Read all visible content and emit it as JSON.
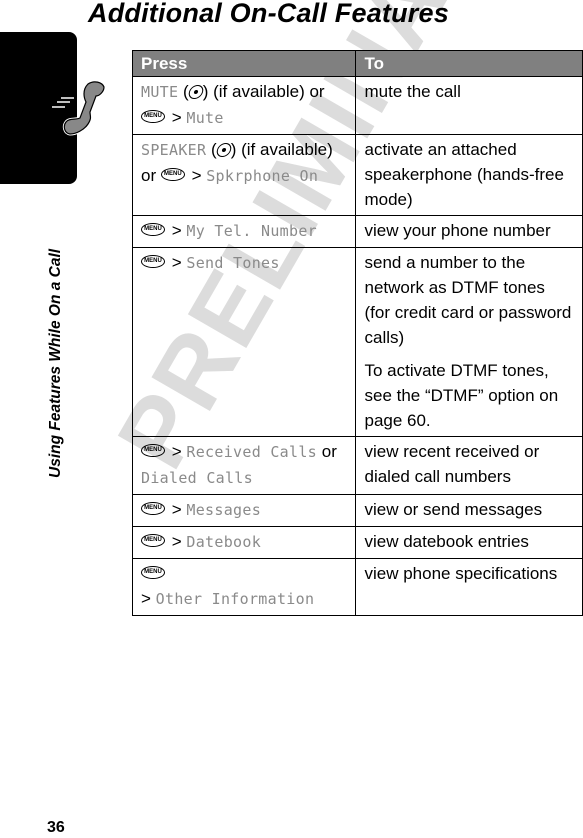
{
  "page": {
    "title": "Additional On-Call Features",
    "section_title": "Using Features While On a Call",
    "page_number": "36",
    "watermark": "PRELIMINARY"
  },
  "table": {
    "headers": [
      "Press",
      "To"
    ],
    "rows": [
      {
        "press": {
          "key_label": "MUTE",
          "open": " (",
          "close": ") (if available) or",
          "sep": " > ",
          "menu_item": "Mute"
        },
        "to": "mute the call"
      },
      {
        "press": {
          "key_label": "SPEAKER",
          "open": " (",
          "close": ") (if available)",
          "or": "or ",
          "sep": " > ",
          "menu_item": "Spkrphone On"
        },
        "to": "activate an attached speakerphone (hands-free mode)"
      },
      {
        "press": {
          "sep": " > ",
          "menu_item": "My Tel. Number"
        },
        "to": "view your phone number"
      },
      {
        "press": {
          "sep": " > ",
          "menu_item": "Send Tones"
        },
        "to": "send a number to the network as DTMF tones (for credit card or password calls)",
        "note": "To activate DTMF tones, see the “DTMF” option on page 60."
      },
      {
        "press": {
          "sep": " > ",
          "menu_item": "Received Calls",
          "or": " or ",
          "menu_item2": "Dialed Calls"
        },
        "to": "view recent received or dialed call numbers"
      },
      {
        "press": {
          "sep": " > ",
          "menu_item": "Messages"
        },
        "to": "view or send messages"
      },
      {
        "press": {
          "sep": " > ",
          "menu_item": "Datebook"
        },
        "to": "view datebook entries"
      },
      {
        "press": {
          "sep": "> ",
          "menu_item": "Other Information"
        },
        "to": "view phone specifications"
      }
    ]
  },
  "icons": {
    "menu_key_label": "MENU",
    "phone_icon": "phone-handset-icon",
    "softkey_icon": "softkey-icon"
  },
  "colors": {
    "header_bg": "#808080",
    "menu_item_text": "#8a8a8a",
    "watermark": "#dcdcdc"
  }
}
